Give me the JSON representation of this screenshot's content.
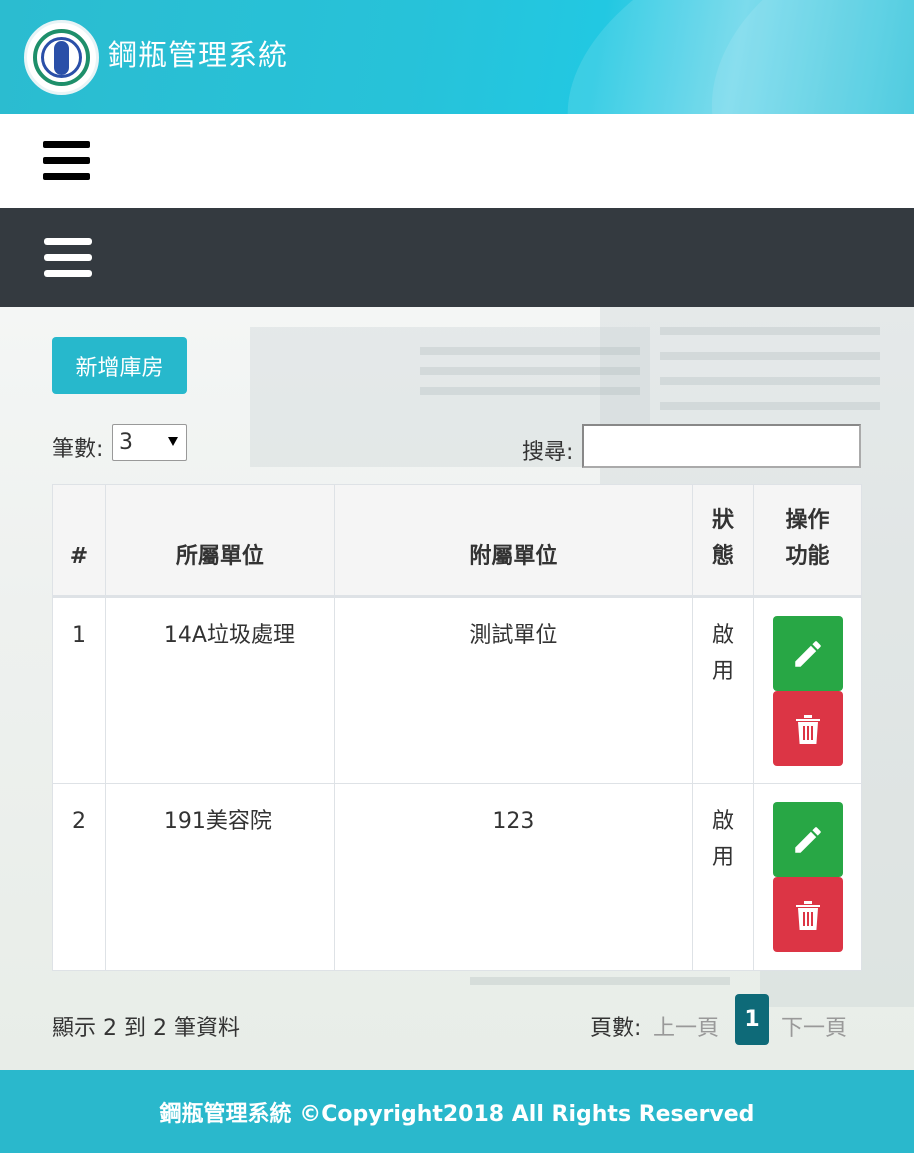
{
  "header": {
    "title": "鋼瓶管理系統",
    "logo_icon": "hospital-logo"
  },
  "toolbar": {
    "add_label": "新增庫房"
  },
  "length": {
    "label": "筆數:",
    "value": "3"
  },
  "search": {
    "label": "搜尋:",
    "value": "",
    "placeholder": ""
  },
  "table": {
    "columns": {
      "num": "#",
      "unit": "所屬單位",
      "sub": "附屬單位",
      "status": "狀態",
      "actions": "操作功能"
    },
    "rows": [
      {
        "num": "1",
        "unit": "14A垃圾處理",
        "sub": "測試單位",
        "status": "啟用"
      },
      {
        "num": "2",
        "unit": "191美容院",
        "sub": "123",
        "status": "啟用"
      }
    ]
  },
  "pagination": {
    "info": "顯示 2 到 2 筆資料",
    "label": "頁數:",
    "prev": "上一頁",
    "current": "1",
    "next": "下一頁"
  },
  "footer": {
    "text": "鋼瓶管理系統 ©Copyright2018 All Rights Reserved"
  },
  "colors": {
    "header": "#27c2d9",
    "dark_nav": "#343a40",
    "primary": "#27b8cc",
    "edit": "#28a745",
    "delete": "#dc3545",
    "page_active": "#0e6a78"
  }
}
